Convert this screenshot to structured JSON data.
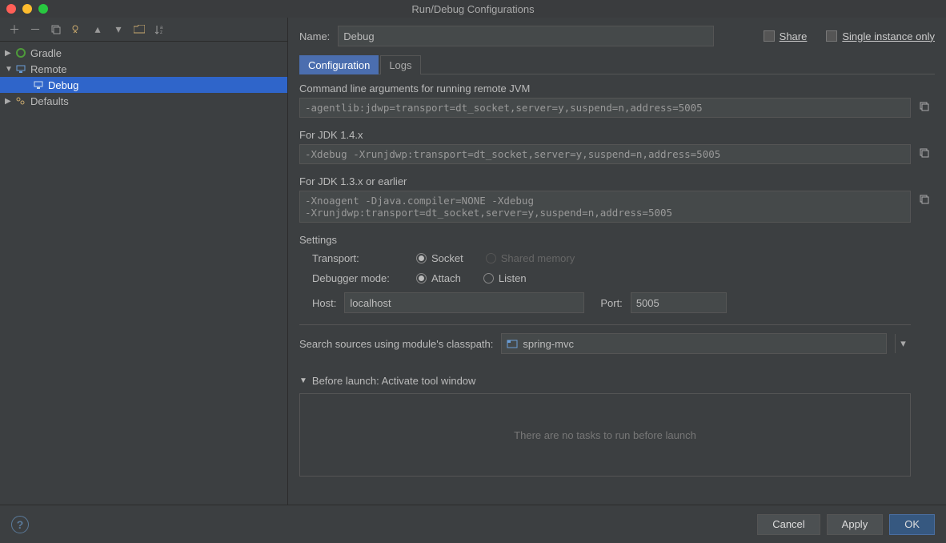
{
  "window": {
    "title": "Run/Debug Configurations"
  },
  "sidebar": {
    "items": [
      {
        "label": "Gradle",
        "expandable": true,
        "expanded": false
      },
      {
        "label": "Remote",
        "expandable": true,
        "expanded": true,
        "children": [
          {
            "label": "Debug",
            "selected": true
          }
        ]
      },
      {
        "label": "Defaults",
        "expandable": true,
        "expanded": false
      }
    ]
  },
  "form": {
    "name_label": "Name:",
    "name_value": "Debug",
    "share_label": "Share",
    "single_instance_label": "Single instance only",
    "tabs": {
      "configuration": "Configuration",
      "logs": "Logs"
    },
    "cmd_label": "Command line arguments for running remote JVM",
    "cmd_value": "-agentlib:jdwp=transport=dt_socket,server=y,suspend=n,address=5005",
    "jdk14_label": "For JDK 1.4.x",
    "jdk14_value": "-Xdebug -Xrunjdwp:transport=dt_socket,server=y,suspend=n,address=5005",
    "jdk13_label": "For JDK 1.3.x or earlier",
    "jdk13_value": "-Xnoagent -Djava.compiler=NONE -Xdebug\n-Xrunjdwp:transport=dt_socket,server=y,suspend=n,address=5005",
    "settings_title": "Settings",
    "transport_label": "Transport:",
    "transport_socket": "Socket",
    "transport_shared": "Shared memory",
    "debugger_label": "Debugger mode:",
    "debugger_attach": "Attach",
    "debugger_listen": "Listen",
    "host_label": "Host:",
    "host_value": "localhost",
    "port_label": "Port:",
    "port_value": "5005",
    "module_label": "Search sources using module's classpath:",
    "module_value": "spring-mvc",
    "before_launch_title": "Before launch: Activate tool window",
    "before_launch_empty": "There are no tasks to run before launch"
  },
  "footer": {
    "cancel": "Cancel",
    "apply": "Apply",
    "ok": "OK"
  }
}
